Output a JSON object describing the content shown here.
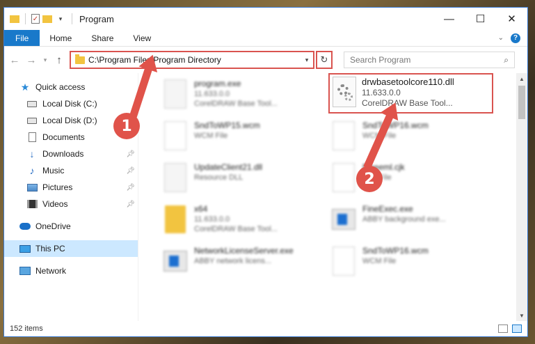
{
  "window": {
    "title": "Program",
    "controls": {
      "minimize": "—",
      "maximize": "☐",
      "close": "✕"
    }
  },
  "ribbon": {
    "tabs": [
      "File",
      "Home",
      "Share",
      "View"
    ],
    "help": "?"
  },
  "address": {
    "path": "C:\\Program Files\\Program Directory",
    "search_placeholder": "Search Program"
  },
  "sidebar": {
    "items": [
      {
        "label": "Quick access",
        "icon": "star-icon"
      },
      {
        "label": "Local Disk (C:)",
        "icon": "disk-icon"
      },
      {
        "label": "Local Disk (D:)",
        "icon": "disk-icon"
      },
      {
        "label": "Documents",
        "icon": "document-icon"
      },
      {
        "label": "Downloads",
        "icon": "download-icon",
        "pinned": true
      },
      {
        "label": "Music",
        "icon": "music-icon",
        "pinned": true
      },
      {
        "label": "Pictures",
        "icon": "pictures-icon",
        "pinned": true
      },
      {
        "label": "Videos",
        "icon": "videos-icon",
        "pinned": true
      },
      {
        "label": "OneDrive",
        "icon": "cloud-icon"
      },
      {
        "label": "This PC",
        "icon": "computer-icon",
        "selected": true
      },
      {
        "label": "Network",
        "icon": "network-icon"
      }
    ]
  },
  "files": {
    "left": [
      {
        "name": "program.exe",
        "line2": "11.633.0.0",
        "line3": "CorelDRAW Base Tool...",
        "kind": "gear"
      },
      {
        "name": "SndToWP15.wcm",
        "line2": "WCM File",
        "line3": "",
        "kind": "doc"
      },
      {
        "name": "UpdateClient21.dll",
        "line2": "Resource DLL",
        "line3": "",
        "kind": "gear"
      },
      {
        "name": "x64",
        "line2": "11.633.0.0",
        "line3": "CorelDRAW Base Tool...",
        "kind": "folder"
      },
      {
        "name": "NetworkLicenseServer.exe",
        "line2": "ABBY network licens...",
        "line3": "",
        "kind": "exe"
      }
    ],
    "right": [
      {
        "name": "SndToWP16.wcm",
        "line2": "WCM File",
        "line3": "",
        "kind": "doc"
      },
      {
        "name": "Fineeml.cjk",
        "line2": "CJK File",
        "line3": "",
        "kind": "doc"
      },
      {
        "name": "FineExec.exe",
        "line2": "ABBY background exe...",
        "line3": "",
        "kind": "exe"
      },
      {
        "name": "SndToWP16.wcm",
        "line2": "WCM File",
        "line3": "",
        "kind": "doc"
      }
    ],
    "highlighted": {
      "name": "drwbasetoolcore110.dll",
      "version": "11.633.0.0",
      "description": "CorelDRAW Base Tool..."
    }
  },
  "status": {
    "item_count": "152 items"
  },
  "annotations": {
    "step1": "1",
    "step2": "2",
    "color": "#e0534a"
  }
}
